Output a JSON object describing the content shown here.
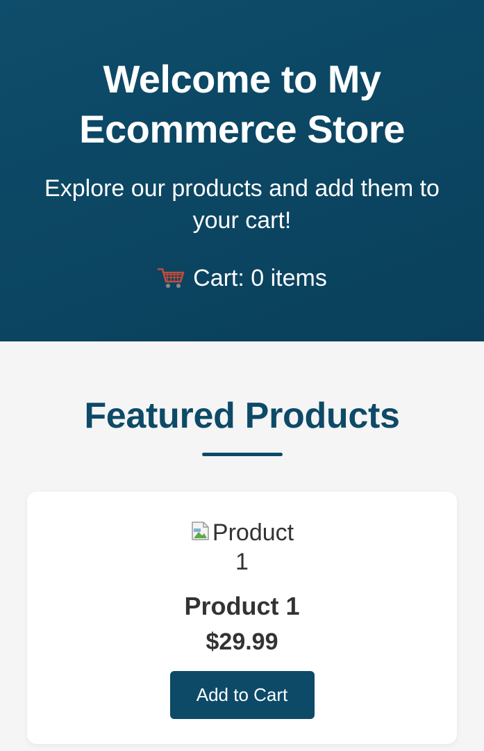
{
  "header": {
    "title": "Welcome to My Ecommerce Store",
    "subtitle": "Explore our products and add them to your cart!",
    "cart_icon": "shopping-cart-icon",
    "cart_text": "Cart: 0 items"
  },
  "featured": {
    "heading": "Featured Products"
  },
  "products": [
    {
      "image_alt": "Product 1",
      "name": "Product 1",
      "price": "$29.99",
      "button_label": "Add to Cart"
    }
  ],
  "colors": {
    "primary": "#0d4a68",
    "background": "#f5f5f5",
    "card": "#ffffff",
    "text": "#333333"
  }
}
